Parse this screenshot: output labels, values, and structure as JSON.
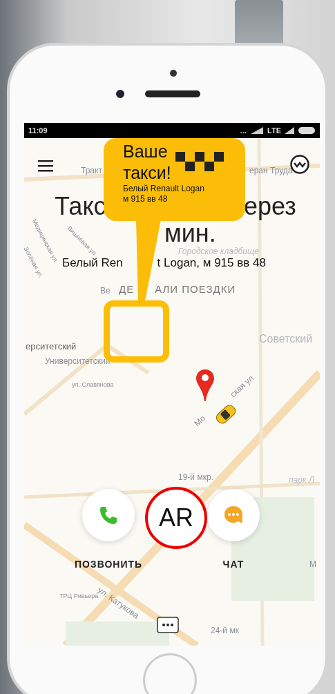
{
  "status_bar": {
    "time": "11:09",
    "dots": "...",
    "network": "LTE"
  },
  "title_parts": [
    "Такс",
    "ерез",
    "мин."
  ],
  "car_parts": [
    "Белый Ren",
    "t Logan, м 915 вв 48"
  ],
  "details_parts": [
    "ДЕ",
    "АЛИ ПОЕЗДКИ"
  ],
  "callout": {
    "title_lines": [
      "Ваше",
      "такси!"
    ],
    "detail_lines": [
      "Белый Renault Logan",
      "м 915 вв 48"
    ]
  },
  "map_labels": [
    {
      "text": "Тракт"
    },
    {
      "text": "еран Труда"
    },
    {
      "text": "Вишнёвая ул."
    },
    {
      "text": "Медицинская ул."
    },
    {
      "text": "Зелёная ул."
    },
    {
      "text": "Городское кладбище"
    },
    {
      "text": "Ве"
    },
    {
      "text": "ерситетский"
    },
    {
      "text": "Университетский"
    },
    {
      "text": "ул. Славянова"
    },
    {
      "text": "Советский"
    },
    {
      "text": "Мо"
    },
    {
      "text": "ская ул"
    },
    {
      "text": "19-й мкр."
    },
    {
      "text": "парк Л"
    },
    {
      "text": "ул. Катукова"
    },
    {
      "text": "ТРЦ Ривьера"
    },
    {
      "text": "24-й мк"
    },
    {
      "text": "М"
    }
  ],
  "actions": [
    {
      "kind": "call",
      "label": "ПОЗВОНИТЬ"
    },
    {
      "kind": "chat",
      "label": "ЧАТ"
    }
  ],
  "ar_badge": {
    "text": "AR"
  }
}
